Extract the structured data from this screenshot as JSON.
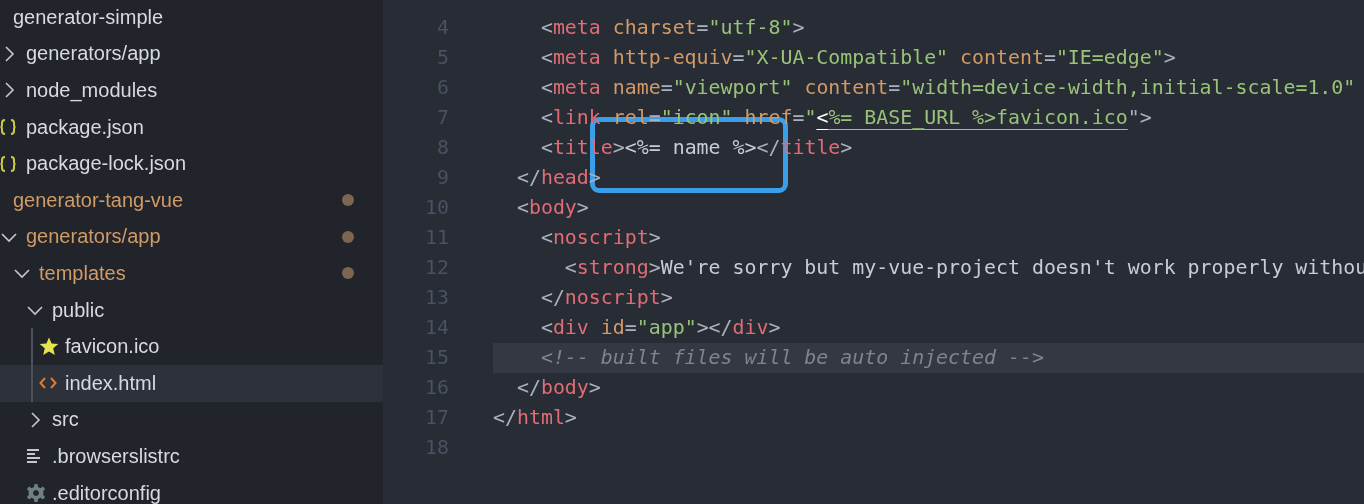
{
  "explorer": {
    "items": [
      {
        "label": "generator-simple",
        "kind": "folder",
        "modified": false,
        "selected": false,
        "children": [
          {
            "label": "generators/app",
            "kind": "folder",
            "expanded": false,
            "modified": false,
            "selected": false
          },
          {
            "label": "node_modules",
            "kind": "folder",
            "expanded": false,
            "modified": false,
            "selected": false
          },
          {
            "label": "package.json",
            "kind": "json-file",
            "modified": false,
            "selected": false
          },
          {
            "label": "package-lock.json",
            "kind": "json-file",
            "modified": false,
            "selected": false
          }
        ]
      },
      {
        "label": "generator-tang-vue",
        "kind": "folder",
        "modified": true,
        "selected": false,
        "children": [
          {
            "label": "generators/app",
            "kind": "folder",
            "expanded": true,
            "modified": true,
            "selected": false,
            "children": [
              {
                "label": "templates",
                "kind": "folder",
                "expanded": true,
                "modified": true,
                "selected": false,
                "children": [
                  {
                    "label": "public",
                    "kind": "folder",
                    "expanded": true,
                    "modified": false,
                    "selected": false,
                    "children": [
                      {
                        "label": "favicon.ico",
                        "kind": "image-file",
                        "modified": false,
                        "selected": false
                      },
                      {
                        "label": "index.html",
                        "kind": "html-file",
                        "modified": false,
                        "selected": true
                      }
                    ]
                  },
                  {
                    "label": "src",
                    "kind": "folder",
                    "expanded": false,
                    "modified": false,
                    "selected": false
                  },
                  {
                    "label": ".browserslistrc",
                    "kind": "text-file",
                    "modified": false,
                    "selected": false
                  },
                  {
                    "label": ".editorconfig",
                    "kind": "config-file",
                    "modified": false,
                    "selected": false
                  }
                ]
              }
            ]
          }
        ]
      }
    ]
  },
  "editor": {
    "annotation": {
      "kind": "rounded-box"
    },
    "lines": [
      {
        "number": "4",
        "current": false,
        "tokens": [
          {
            "kind": "punct",
            "text": "    <"
          },
          {
            "kind": "tag",
            "text": "meta"
          },
          {
            "kind": "attr",
            "text": " charset"
          },
          {
            "kind": "punct",
            "text": "="
          },
          {
            "kind": "string",
            "text": "\"utf-8\""
          },
          {
            "kind": "punct",
            "text": ">"
          }
        ]
      },
      {
        "number": "5",
        "current": false,
        "tokens": [
          {
            "kind": "punct",
            "text": "    <"
          },
          {
            "kind": "tag",
            "text": "meta"
          },
          {
            "kind": "attr",
            "text": " http-equiv"
          },
          {
            "kind": "punct",
            "text": "="
          },
          {
            "kind": "string",
            "text": "\"X-UA-Compatible\""
          },
          {
            "kind": "attr",
            "text": " content"
          },
          {
            "kind": "punct",
            "text": "="
          },
          {
            "kind": "string",
            "text": "\"IE=edge\""
          },
          {
            "kind": "punct",
            "text": ">"
          }
        ]
      },
      {
        "number": "6",
        "current": false,
        "tokens": [
          {
            "kind": "punct",
            "text": "    <"
          },
          {
            "kind": "tag",
            "text": "meta"
          },
          {
            "kind": "attr",
            "text": " name"
          },
          {
            "kind": "punct",
            "text": "="
          },
          {
            "kind": "string",
            "text": "\"viewport\""
          },
          {
            "kind": "attr",
            "text": " content"
          },
          {
            "kind": "punct",
            "text": "="
          },
          {
            "kind": "string",
            "text": "\"width=device-width,initial-scale=1.0\""
          }
        ]
      },
      {
        "number": "7",
        "current": false,
        "tokens": [
          {
            "kind": "punct",
            "text": "    <"
          },
          {
            "kind": "tag",
            "text": "link"
          },
          {
            "kind": "attr",
            "text": " rel"
          },
          {
            "kind": "punct",
            "text": "="
          },
          {
            "kind": "string",
            "text": "\"icon\""
          },
          {
            "kind": "attr",
            "text": " href"
          },
          {
            "kind": "punct",
            "text": "="
          },
          {
            "kind": "string",
            "text": "\""
          },
          {
            "kind": "link-bright",
            "text": "<"
          },
          {
            "kind": "link",
            "text": "%= BASE_URL %>favicon.ico"
          },
          {
            "kind": "punct",
            "text": "\">"
          }
        ]
      },
      {
        "number": "8",
        "current": false,
        "tokens": [
          {
            "kind": "punct",
            "text": "    <"
          },
          {
            "kind": "tag",
            "text": "title"
          },
          {
            "kind": "punct",
            "text": ">"
          },
          {
            "kind": "plain",
            "text": "<%= name %>"
          },
          {
            "kind": "punct",
            "text": "</"
          },
          {
            "kind": "tag",
            "text": "title"
          },
          {
            "kind": "punct",
            "text": ">"
          }
        ]
      },
      {
        "number": "9",
        "current": false,
        "tokens": [
          {
            "kind": "punct",
            "text": "  </"
          },
          {
            "kind": "tag",
            "text": "head"
          },
          {
            "kind": "punct",
            "text": ">"
          }
        ]
      },
      {
        "number": "10",
        "current": false,
        "tokens": [
          {
            "kind": "punct",
            "text": "  <"
          },
          {
            "kind": "tag",
            "text": "body"
          },
          {
            "kind": "punct",
            "text": ">"
          }
        ]
      },
      {
        "number": "11",
        "current": false,
        "tokens": [
          {
            "kind": "punct",
            "text": "    <"
          },
          {
            "kind": "tag",
            "text": "noscript"
          },
          {
            "kind": "punct",
            "text": ">"
          }
        ]
      },
      {
        "number": "12",
        "current": false,
        "tokens": [
          {
            "kind": "punct",
            "text": "      <"
          },
          {
            "kind": "tag",
            "text": "strong"
          },
          {
            "kind": "punct",
            "text": ">"
          },
          {
            "kind": "plain",
            "text": "We're sorry but my-vue-project doesn't work properly withou"
          }
        ]
      },
      {
        "number": "13",
        "current": false,
        "tokens": [
          {
            "kind": "punct",
            "text": "    </"
          },
          {
            "kind": "tag",
            "text": "noscript"
          },
          {
            "kind": "punct",
            "text": ">"
          }
        ]
      },
      {
        "number": "14",
        "current": false,
        "tokens": [
          {
            "kind": "punct",
            "text": "    <"
          },
          {
            "kind": "tag",
            "text": "div"
          },
          {
            "kind": "attr",
            "text": " id"
          },
          {
            "kind": "punct",
            "text": "="
          },
          {
            "kind": "string",
            "text": "\"app\""
          },
          {
            "kind": "punct",
            "text": "></"
          },
          {
            "kind": "tag",
            "text": "div"
          },
          {
            "kind": "punct",
            "text": ">"
          }
        ]
      },
      {
        "number": "15",
        "current": true,
        "tokens": [
          {
            "kind": "comment",
            "text": "    <!-- built files will be auto injected -->"
          }
        ]
      },
      {
        "number": "16",
        "current": false,
        "tokens": [
          {
            "kind": "punct",
            "text": "  </"
          },
          {
            "kind": "tag",
            "text": "body"
          },
          {
            "kind": "punct",
            "text": ">"
          }
        ]
      },
      {
        "number": "17",
        "current": false,
        "tokens": [
          {
            "kind": "punct",
            "text": "</"
          },
          {
            "kind": "tag",
            "text": "html"
          },
          {
            "kind": "punct",
            "text": ">"
          }
        ]
      },
      {
        "number": "18",
        "current": false
      }
    ]
  }
}
